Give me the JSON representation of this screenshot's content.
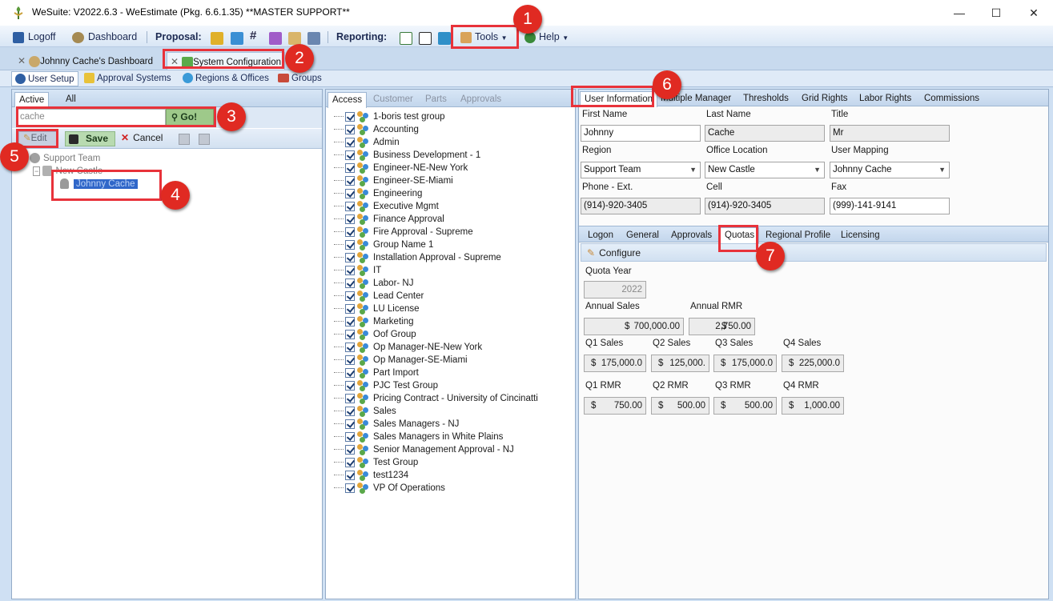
{
  "window": {
    "title": "WeSuite: V2022.6.3 - WeEstimate (Pkg. 6.6.1.35) **MASTER SUPPORT**",
    "minimize": "—",
    "maximize": "☐",
    "close": "✕"
  },
  "toolbar": {
    "logoff": "Logoff",
    "dashboard": "Dashboard",
    "proposal_label": "Proposal:",
    "reporting_label": "Reporting:",
    "tools": "Tools",
    "help": "Help"
  },
  "doc_tabs": {
    "dashboard": "Johnny Cache's Dashboard",
    "system_configuration": "System Configuration",
    "close_glyph": "✕"
  },
  "sub_tabs": [
    "User Setup",
    "Approval Systems",
    "Regions & Offices",
    "Groups"
  ],
  "left_panel": {
    "tabs": [
      "Active",
      "All"
    ],
    "search_value": "cache",
    "go_button": "Go!",
    "edit": "Edit",
    "save": "Save",
    "cancel": "Cancel",
    "tree": {
      "region": "Support Team",
      "office": "New Castle",
      "user": "Johnny Cache"
    }
  },
  "middle_panel": {
    "tabs": [
      "Access",
      "Customer",
      "Parts",
      "Approvals"
    ],
    "groups": [
      "1-boris test group",
      "Accounting",
      "Admin",
      "Business Development - 1",
      "Engineer-NE-New York",
      "Engineer-SE-Miami",
      "Engineering",
      "Executive Mgmt",
      "Finance Approval",
      "Fire Approval - Supreme",
      "Group Name 1",
      "Installation Approval - Supreme",
      "IT",
      "Labor- NJ",
      "Lead Center",
      "LU License",
      "Marketing",
      "Oof Group",
      "Op Manager-NE-New York",
      "Op Manager-SE-Miami",
      "Part Import",
      "PJC Test Group",
      "Pricing Contract - University of Cincinatti",
      "Sales",
      "Sales Managers - NJ",
      "Sales Managers in White Plains",
      "Senior Management Approval - NJ",
      "Test Group",
      "test1234",
      "VP Of Operations"
    ]
  },
  "right_panel": {
    "tabs": [
      "User Information",
      "Multiple Manager",
      "Thresholds",
      "Grid Rights",
      "Labor Rights",
      "Commissions"
    ],
    "fields": {
      "first_name_label": "First Name",
      "first_name": "Johnny",
      "last_name_label": "Last Name",
      "last_name": "Cache",
      "title_label": "Title",
      "title": "Mr",
      "region_label": "Region",
      "region": "Support Team",
      "office_label": "Office Location",
      "office": "New Castle",
      "mapping_label": "User Mapping",
      "mapping": "Johnny Cache",
      "phone_label": "Phone - Ext.",
      "phone": "(914)-920-3405",
      "cell_label": "Cell",
      "cell": "(914)-920-3405",
      "fax_label": "Fax",
      "fax": "(999)-141-9141"
    },
    "inner_tabs": [
      "Logon",
      "General",
      "Approvals",
      "Quotas",
      "Regional Profile",
      "Licensing"
    ],
    "configure": "Configure",
    "quotas": {
      "year_label": "Quota Year",
      "year": "2022",
      "annual_sales_label": "Annual Sales",
      "annual_sales": "700,000.00",
      "annual_rmr_label": "Annual RMR",
      "annual_rmr": "2,750.00",
      "q1_sales_label": "Q1 Sales",
      "q1_sales": "175,000.0",
      "q2_sales_label": "Q2 Sales",
      "q2_sales": "125,000.",
      "q3_sales_label": "Q3 Sales",
      "q3_sales": "175,000.0",
      "q4_sales_label": "Q4 Sales",
      "q4_sales": "225,000.0",
      "q1_rmr_label": "Q1 RMR",
      "q1_rmr": "750.00",
      "q2_rmr_label": "Q2 RMR",
      "q2_rmr": "500.00",
      "q3_rmr_label": "Q3 RMR",
      "q3_rmr": "500.00",
      "q4_rmr_label": "Q4 RMR",
      "q4_rmr": "1,000.00",
      "currency": "$"
    }
  },
  "callouts": [
    "1",
    "2",
    "3",
    "4",
    "5",
    "6",
    "7"
  ],
  "colors": {
    "callout": "#e02a22",
    "highlight": "#e8323a",
    "selection": "#3067c9"
  }
}
